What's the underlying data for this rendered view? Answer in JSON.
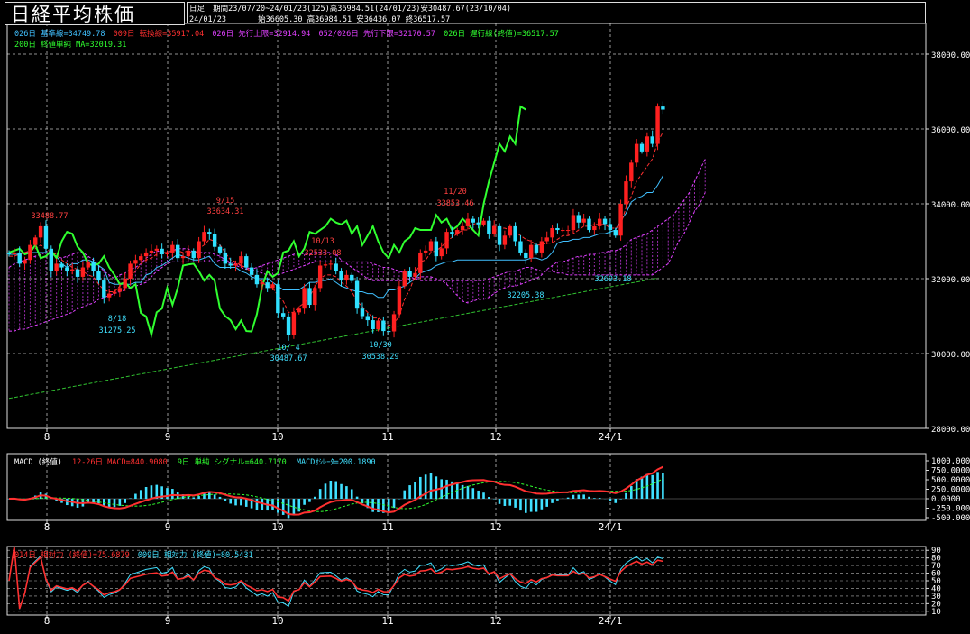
{
  "title": "日経平均株価",
  "info": {
    "period_label": "日足",
    "period_text": "期間23/07/20~24/01/23(125)高36984.51(24/01/23)安30487.67(23/10/04)",
    "date": "24/01/23",
    "ohlc": "始36605.30 高36984.51 安36436.07 終36517.57"
  },
  "legends": {
    "main1": [
      {
        "text": "026日 基準線=34749.78",
        "color": "#40c0ff"
      },
      {
        "text": "009日 転換線=35917.04",
        "color": "#ff3030"
      },
      {
        "text": "026日 先行上限=32914.94",
        "color": "#e040ff"
      },
      {
        "text": "052/026日 先行下限=32170.57",
        "color": "#e040ff"
      },
      {
        "text": "026日 遅行線(終値)=36517.57",
        "color": "#30ff30"
      }
    ],
    "main2": [
      {
        "text": "200日 終値単純 MA=32019.31",
        "color": "#30ff30"
      }
    ],
    "macd": [
      {
        "text": "MACD (終値)",
        "color": "#ffffff"
      },
      {
        "text": "12-26日 MACD=840.9080",
        "color": "#ff3030"
      },
      {
        "text": "9日 単純 シグナル=640.7170",
        "color": "#30ff30"
      },
      {
        "text": "MACDｵｼﾚｰﾀ=200.1890",
        "color": "#40e0ff"
      }
    ],
    "rsi": [
      {
        "text": "014日 相対力 (終値)=75.6879",
        "color": "#ff3030"
      },
      {
        "text": "009日 相対力 (終値)=80.5431",
        "color": "#40e0ff"
      }
    ]
  },
  "colors": {
    "up": "#ff2020",
    "down": "#30e0ff",
    "kijun": "#40c0ff",
    "tenkan": "#ff3030",
    "chikou": "#30ff30",
    "cloud": "#e040ff",
    "ma200": "#30c030",
    "grid": "#ffffff"
  },
  "chart_data": [
    {
      "type": "candlestick",
      "name": "price",
      "y_ticks": [
        "38000.00",
        "36000.00",
        "34000.00",
        "32000.00",
        "30000.00",
        "28000.00"
      ],
      "ylim": [
        28000,
        39000
      ],
      "x_ticks": [
        "8",
        "9",
        "10",
        "11",
        "12",
        "24/1"
      ],
      "annotations": [
        {
          "date": "8/1",
          "text": "33488.77"
        },
        {
          "date": "8/18",
          "text": "8/18"
        },
        {
          "date": "8/18",
          "text": "31275.25"
        },
        {
          "date": "9/15",
          "text": "9/15"
        },
        {
          "date": "9/15",
          "text": "33634.31"
        },
        {
          "date": "10/4",
          "text": "10/ 4"
        },
        {
          "date": "10/4",
          "text": "30487.67"
        },
        {
          "date": "10/13",
          "text": "10/13"
        },
        {
          "date": "10/13",
          "text": "32533.08"
        },
        {
          "date": "10/30",
          "text": "10/30"
        },
        {
          "date": "10/30",
          "text": "30538.29"
        },
        {
          "date": "11/20",
          "text": "11/20"
        },
        {
          "date": "11/20",
          "text": "33853.46"
        },
        {
          "date": "12/6",
          "text": "32205.38"
        },
        {
          "date": "1/4",
          "text": "32693.18"
        }
      ],
      "close": [
        32650,
        32700,
        32400,
        32500,
        32900,
        33100,
        33400,
        32800,
        32200,
        32400,
        32300,
        32200,
        32250,
        32050,
        32300,
        32450,
        32200,
        31950,
        31500,
        31600,
        31650,
        31750,
        32000,
        32400,
        32500,
        32600,
        32700,
        32750,
        32800,
        32650,
        32700,
        32900,
        32550,
        32600,
        32750,
        32550,
        33000,
        33250,
        33200,
        32850,
        32700,
        32400,
        32350,
        32400,
        32600,
        32300,
        32100,
        31850,
        31900,
        31750,
        31850,
        31080,
        30990,
        30500,
        31100,
        31200,
        31750,
        31300,
        31750,
        32350,
        32380,
        32400,
        32200,
        31950,
        32100,
        31940,
        31200,
        31000,
        30890,
        30650,
        30880,
        30600,
        30590,
        31050,
        31800,
        32200,
        32050,
        32150,
        32700,
        32750,
        33000,
        32600,
        32810,
        33250,
        33200,
        33300,
        33400,
        33600,
        33500,
        33450,
        33550,
        33200,
        33400,
        32900,
        33150,
        33400,
        33000,
        32700,
        32550,
        32900,
        32700,
        33000,
        33100,
        33350,
        33300,
        33300,
        33300,
        33700,
        33500,
        33600,
        33300,
        33400,
        33600,
        33460,
        33300,
        33150,
        34000,
        34600,
        35100,
        35600,
        35400,
        35800,
        35600,
        36600,
        36517
      ],
      "price_start": 32700,
      "ma200": {
        "start": 28800,
        "end": 32019.31
      },
      "kijun": [
        32650,
        32650,
        32650,
        32700,
        32700,
        32700,
        32700,
        32700,
        32650,
        32600,
        32400,
        32300,
        32400,
        32400,
        32500,
        32500,
        32450,
        32350,
        32250,
        31900,
        31850,
        31850,
        31850,
        31850,
        31900,
        31900,
        32100,
        32150,
        32300,
        32350,
        32450,
        32550,
        32650,
        32600,
        32550,
        32500,
        32500,
        32550,
        32600,
        32400,
        32300,
        32300,
        32300,
        32300,
        32200,
        32150,
        32050,
        32000,
        32000,
        32000,
        31900,
        31800,
        31700,
        31700,
        31700,
        31700,
        31800,
        31900,
        31900,
        31950,
        31950,
        32000,
        31900,
        31800,
        31750,
        31700,
        31650,
        31650,
        31600,
        31600,
        31500,
        31500,
        31700,
        31700,
        31750,
        31800,
        31900,
        32000,
        32150,
        32200,
        32250,
        32350,
        32400,
        32450,
        32450,
        32500,
        32500,
        32500,
        32500,
        32500,
        32500,
        32500,
        32500,
        32500,
        32500,
        32500,
        32500,
        32500,
        32500,
        32550,
        32550,
        32500,
        32550,
        32700,
        32950,
        33000,
        33000,
        33050,
        33050,
        33100,
        33100,
        33150,
        33200,
        33200,
        33250,
        33300,
        33550,
        33750,
        34050,
        34150,
        34200,
        34300,
        34300,
        34500,
        34749.78
      ],
      "tenkan": [
        32600,
        32600,
        32650,
        32700,
        32750,
        32800,
        32900,
        32800,
        32700,
        32650,
        32500,
        32400,
        32300,
        32250,
        32200,
        32100,
        32050,
        31850,
        31700,
        31650,
        31650,
        31800,
        31900,
        32050,
        32200,
        32400,
        32500,
        32550,
        32650,
        32700,
        32700,
        32750,
        32750,
        32700,
        32750,
        32650,
        32800,
        32900,
        33050,
        33000,
        32900,
        32700,
        32500,
        32450,
        32350,
        32300,
        32150,
        32000,
        31900,
        31800,
        31750,
        31550,
        31400,
        31100,
        31100,
        31250,
        31350,
        31500,
        31800,
        32000,
        32100,
        32100,
        32050,
        31900,
        31800,
        31650,
        31400,
        31250,
        31100,
        30950,
        30950,
        30850,
        30750,
        30800,
        31000,
        31450,
        31700,
        32100,
        32450,
        32500,
        32700,
        32750,
        32850,
        33000,
        33100,
        33200,
        33300,
        33300,
        33450,
        33500,
        33450,
        33400,
        33400,
        33350,
        33350,
        33300,
        33250,
        33150,
        33050,
        33000,
        32900,
        32900,
        32950,
        32950,
        33050,
        33150,
        33150,
        33200,
        33300,
        33400,
        33400,
        33450,
        33450,
        33450,
        33350,
        33350,
        33450,
        33900,
        34200,
        34600,
        34800,
        35000,
        35200,
        35650,
        35917.04
      ],
      "cloud_a": [
        32300,
        32400,
        32450,
        32500,
        32550,
        32600,
        32650,
        32700,
        32650,
        32600,
        32550,
        32600,
        32650,
        32700,
        32700,
        32600,
        32500,
        32350,
        32200,
        32100,
        32000,
        32100,
        32150,
        32250,
        32300,
        32400,
        32550,
        32650,
        32750,
        32700,
        32700,
        32750,
        32800,
        32800,
        32800,
        32700,
        32700,
        32700,
        32700,
        32650,
        32600,
        32500,
        32400,
        32350,
        32300,
        32250,
        32250,
        32300,
        32350,
        32400,
        32450,
        32500,
        32550,
        32600,
        32650,
        32700,
        32650,
        32650,
        32700,
        32700,
        32700,
        32700,
        32650,
        32500,
        32400,
        32300,
        32200,
        32100,
        32000,
        31950,
        31950,
        31950,
        31950,
        31950,
        31950,
        31950,
        32000,
        32000,
        32050,
        32050,
        32050,
        32000,
        31950,
        31850,
        31700,
        31550,
        31400,
        31350,
        31400,
        31450,
        31450,
        31500,
        31600,
        31700,
        31750,
        31800,
        31800,
        31850,
        31900,
        31950,
        32000,
        32100,
        32250,
        32350,
        32450,
        32450,
        32500,
        32550,
        32600,
        32600,
        32650,
        32650,
        32700,
        32700,
        32750,
        32750,
        32800,
        32900,
        33050,
        33100,
        33150,
        33200,
        33300,
        33400,
        33500,
        33600,
        33700,
        33900,
        34100,
        34300,
        34600,
        34900,
        35200
      ],
      "cloud_b": [
        30600,
        30600,
        30650,
        30650,
        30700,
        30750,
        30800,
        30850,
        30900,
        30950,
        31000,
        31050,
        31100,
        31200,
        31250,
        31300,
        31350,
        31450,
        31500,
        31550,
        31600,
        31650,
        31700,
        31750,
        31800,
        31850,
        31900,
        32050,
        32200,
        32300,
        32400,
        32450,
        32450,
        32450,
        32450,
        32450,
        32450,
        32450,
        32450,
        32450,
        32500,
        32500,
        32450,
        32400,
        32350,
        32300,
        32250,
        32200,
        32150,
        32100,
        32100,
        32100,
        32150,
        32200,
        32250,
        32300,
        32350,
        32400,
        32450,
        32450,
        32450,
        32450,
        32450,
        32450,
        32450,
        32450,
        32450,
        32450,
        32450,
        32400,
        32350,
        32300,
        32300,
        32250,
        32200,
        32150,
        32050,
        32000,
        31950,
        31950,
        31950,
        31950,
        31950,
        31950,
        31950,
        31950,
        31950,
        31950,
        31950,
        31950,
        31950,
        32000,
        32050,
        32100,
        32150,
        32200,
        32200,
        32250,
        32300,
        32300,
        32250,
        32200,
        32200,
        32200,
        32150,
        32150,
        32100,
        32100,
        32100,
        32100,
        32100,
        32100,
        32100,
        32100,
        32100,
        32100,
        32100,
        32100,
        32100,
        32100,
        32100,
        32100,
        32100,
        32200,
        32300,
        32400,
        32700,
        33000,
        33200,
        33500,
        33800,
        34000,
        34300
      ]
    },
    {
      "type": "bar_line",
      "name": "macd",
      "y_ticks": [
        "1000.0000",
        "750.0000",
        "500.0000",
        "250.0000",
        "0.0000",
        "-250.0000",
        "-500.0000"
      ],
      "ylim": [
        -600,
        1000
      ],
      "x_ticks": [
        "8",
        "9",
        "10",
        "11",
        "12",
        "24/1"
      ],
      "macd_last": 840.908,
      "signal_last": 640.717,
      "osc_last": 200.189
    },
    {
      "type": "line",
      "name": "rsi",
      "y_ticks": [
        "90",
        "80",
        "70",
        "60",
        "50",
        "40",
        "30",
        "20",
        "10"
      ],
      "ylim": [
        5,
        95
      ],
      "x_ticks": [
        "8",
        "9",
        "10",
        "11",
        "12",
        "24/1"
      ],
      "rsi14_last": 75.6879,
      "rsi9_last": 80.5431
    }
  ]
}
